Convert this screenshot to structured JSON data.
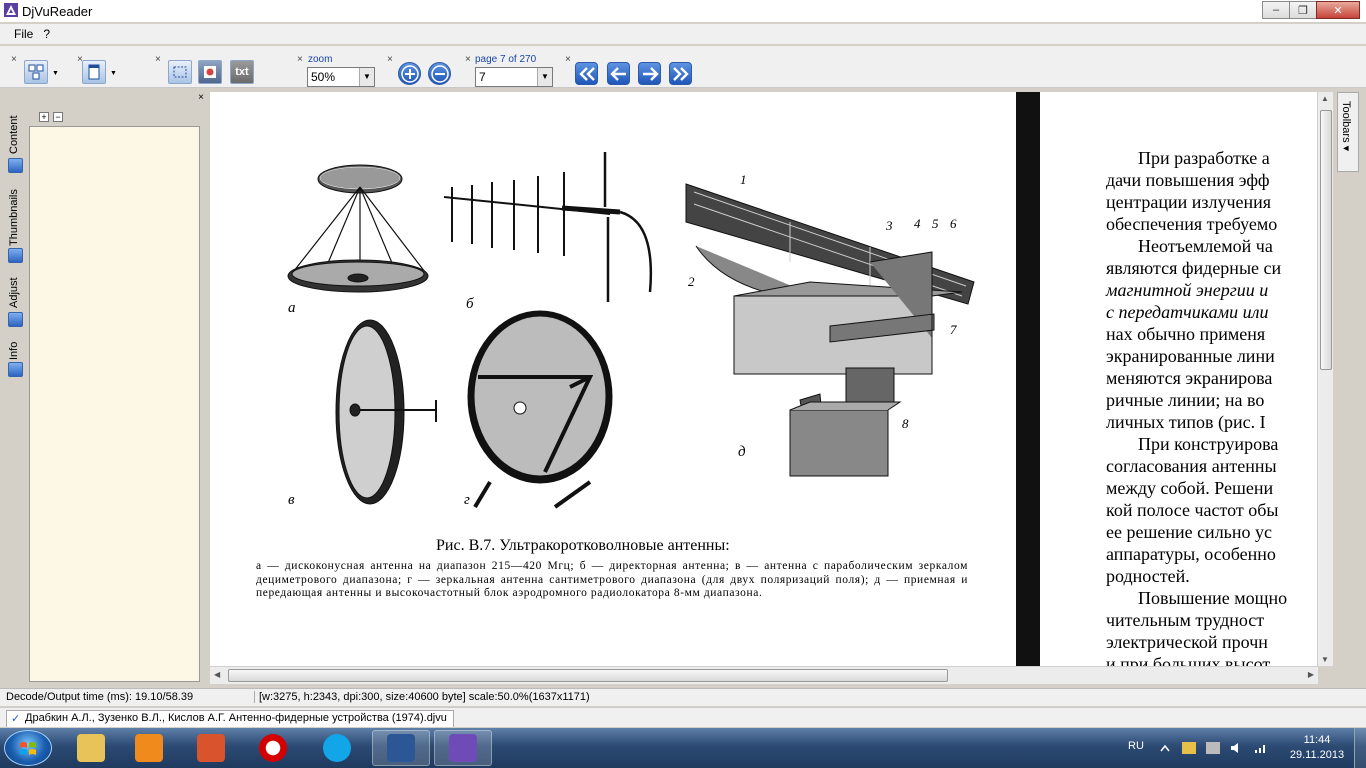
{
  "window": {
    "title": "DjVuReader",
    "minimize_icon": "minimize-icon",
    "restore_icon": "restore-icon",
    "close_icon": "close-icon"
  },
  "menu": {
    "file": "File",
    "help": "?"
  },
  "toolbar": {
    "zoom_label": "zoom",
    "zoom_value": "50%",
    "page_label": "page 7 of 270",
    "page_value": "7",
    "text_button": "txt",
    "close_mark": "×"
  },
  "sidebar": {
    "tabs": [
      {
        "label": "Content",
        "icon": "content-icon"
      },
      {
        "label": "Thumbnails",
        "icon": "thumbnails-icon"
      },
      {
        "label": "Adjust",
        "icon": "adjust-icon"
      },
      {
        "label": "Info",
        "icon": "info-icon"
      }
    ],
    "expand": "+",
    "collapse": "−"
  },
  "right_strip": {
    "label": "Toolbars",
    "arrow": "▾"
  },
  "page_left": {
    "labels": {
      "a": "а",
      "b": "б",
      "v": "в",
      "g": "г",
      "d": "д"
    },
    "numbers": [
      "1",
      "2",
      "3",
      "4",
      "5",
      "6",
      "7",
      "8"
    ],
    "caption_title": "Рис. В.7. Ультракоротковолновые антенны:",
    "caption_body": "а — дискоконусная антенна на диапазон 215—420 Мгц; б — директорная антенна; в — антенна с параболическим зеркалом дециметрового диапазона; г — зеркальная антенна сантиметрового диапазона (для двух поляризаций поля); д — приемная и передающая антенны и высокочастотный блок аэродромного радиолокатора 8-мм диапазона."
  },
  "page_right": {
    "lines": [
      "При разработке а",
      "дачи повышения эфф",
      "центрации излучения",
      "обеспечения требуемо",
      "Неотъемлемой ча",
      "являются фидерные си",
      "магнитной энергии и",
      "с передатчиками или",
      "нах обычно применя",
      "экранированные лини",
      "меняются экранирова",
      "ричные линии; на во",
      "личных типов (рис. I",
      "При конструирова",
      "согласования антенны",
      "между собой. Решени",
      "кой полосе частот обы",
      "ее решение сильно ус",
      "аппаратуры, особенно",
      "родностей.",
      "Повышение мощно",
      "чительным трудност",
      "электрической прочн",
      "и при больших высот"
    ]
  },
  "status": {
    "decode_time": "Decode/Output time (ms): 19.10/58.39",
    "image_info": "[w:3275, h:2343, dpi:300, size:40600 byte] scale:50.0%(1637x1171)"
  },
  "file_tab": {
    "name": "Драбкин А.Л., Зузенко В.Л., Кислов А.Г. Антенно-фидерные устройства (1974).djvu",
    "check": "✓"
  },
  "taskbar": {
    "items": [
      {
        "name": "explorer",
        "icon": "folder-icon",
        "color": "#e8c35a"
      },
      {
        "name": "media-player",
        "icon": "media-player-icon",
        "color": "#f08a1c"
      },
      {
        "name": "tool-app",
        "icon": "toolbox-icon",
        "color": "#d9532c"
      },
      {
        "name": "opera",
        "icon": "opera-icon",
        "color": "#d40000"
      },
      {
        "name": "skype",
        "icon": "skype-icon",
        "color": "#12a5e8"
      },
      {
        "name": "word",
        "icon": "word-icon",
        "color": "#2b5797"
      },
      {
        "name": "djvureader",
        "icon": "djvu-icon",
        "color": "#6f4bb8"
      }
    ],
    "lang": "RU",
    "time": "11:44",
    "date": "29.11.2013"
  }
}
